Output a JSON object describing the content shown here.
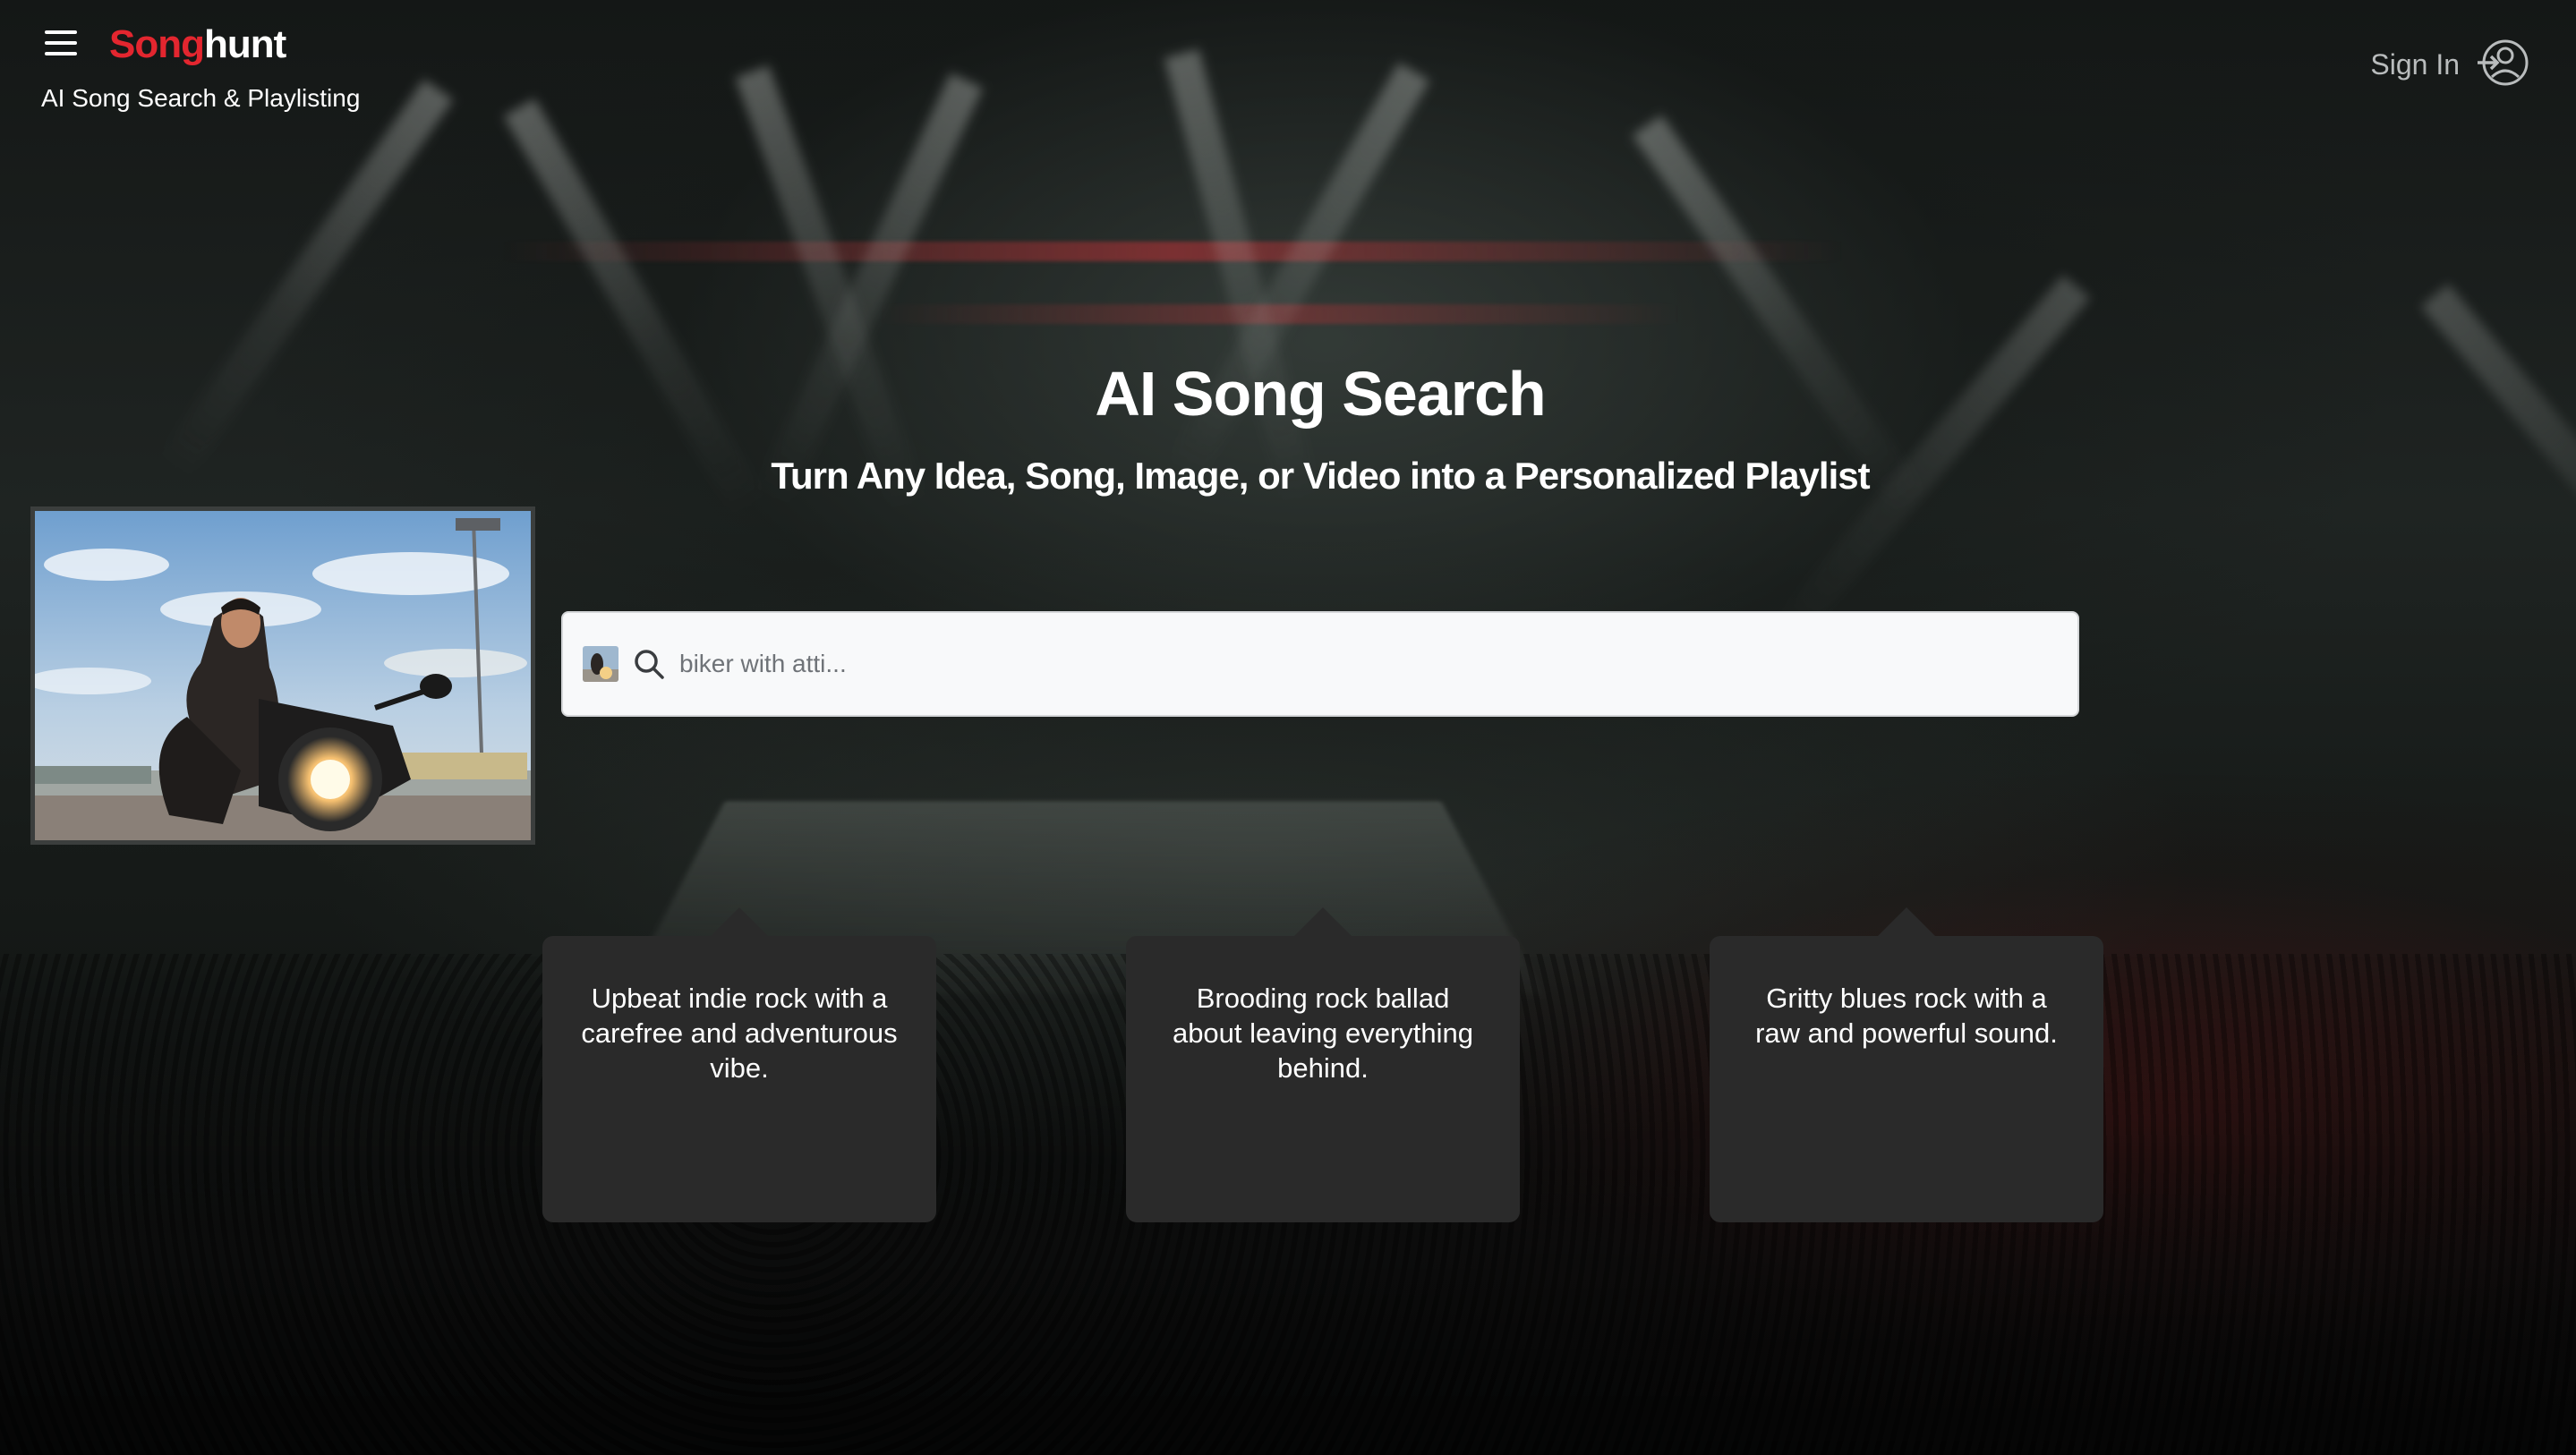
{
  "header": {
    "logo_part1": "Song",
    "logo_part2": "hunt",
    "tagline": "AI Song Search & Playlisting",
    "signin_label": "Sign In"
  },
  "hero": {
    "title": "AI Song Search",
    "subtitle": "Turn Any Idea, Song, Image, or Video into a Personalized Playlist"
  },
  "search": {
    "value": "",
    "placeholder": "biker with atti..."
  },
  "suggestions": [
    {
      "text": "Upbeat indie rock with a carefree and adventurous vibe."
    },
    {
      "text": "Brooding rock ballad about leaving everything behind."
    },
    {
      "text": "Gritty blues rock with a raw and powerful sound."
    }
  ],
  "icons": {
    "menu": "hamburger-menu-icon",
    "signin": "user-sign-in-icon",
    "search": "search-icon"
  },
  "colors": {
    "brand_red": "#e3262f",
    "card_bg": "#2a2a2a",
    "search_bg": "#f8f9fa"
  }
}
